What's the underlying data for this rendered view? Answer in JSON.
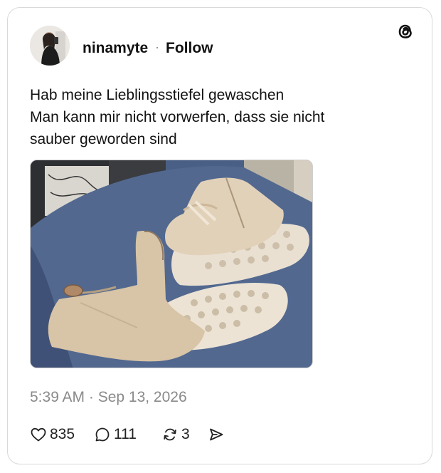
{
  "post": {
    "username": "ninamyte",
    "separator": "·",
    "follow_label": "Follow",
    "text_lines": [
      "Hab meine Lieblingsstiefel gewaschen",
      "Man kann mir nicht vorwerfen, dass sie nicht",
      "sauber geworden sind"
    ],
    "timestamp": "5:39 AM · Sep 13, 2026",
    "image_icon": "photo-of-boots"
  },
  "actions": {
    "likes": "835",
    "replies": "111",
    "reposts": "3",
    "like_icon": "heart-icon",
    "reply_icon": "comment-icon",
    "repost_icon": "repost-icon",
    "share_icon": "send-icon"
  },
  "brand": {
    "logo_icon": "threads-logo-icon",
    "accent": "#111111",
    "muted": "#8a8a8a"
  }
}
